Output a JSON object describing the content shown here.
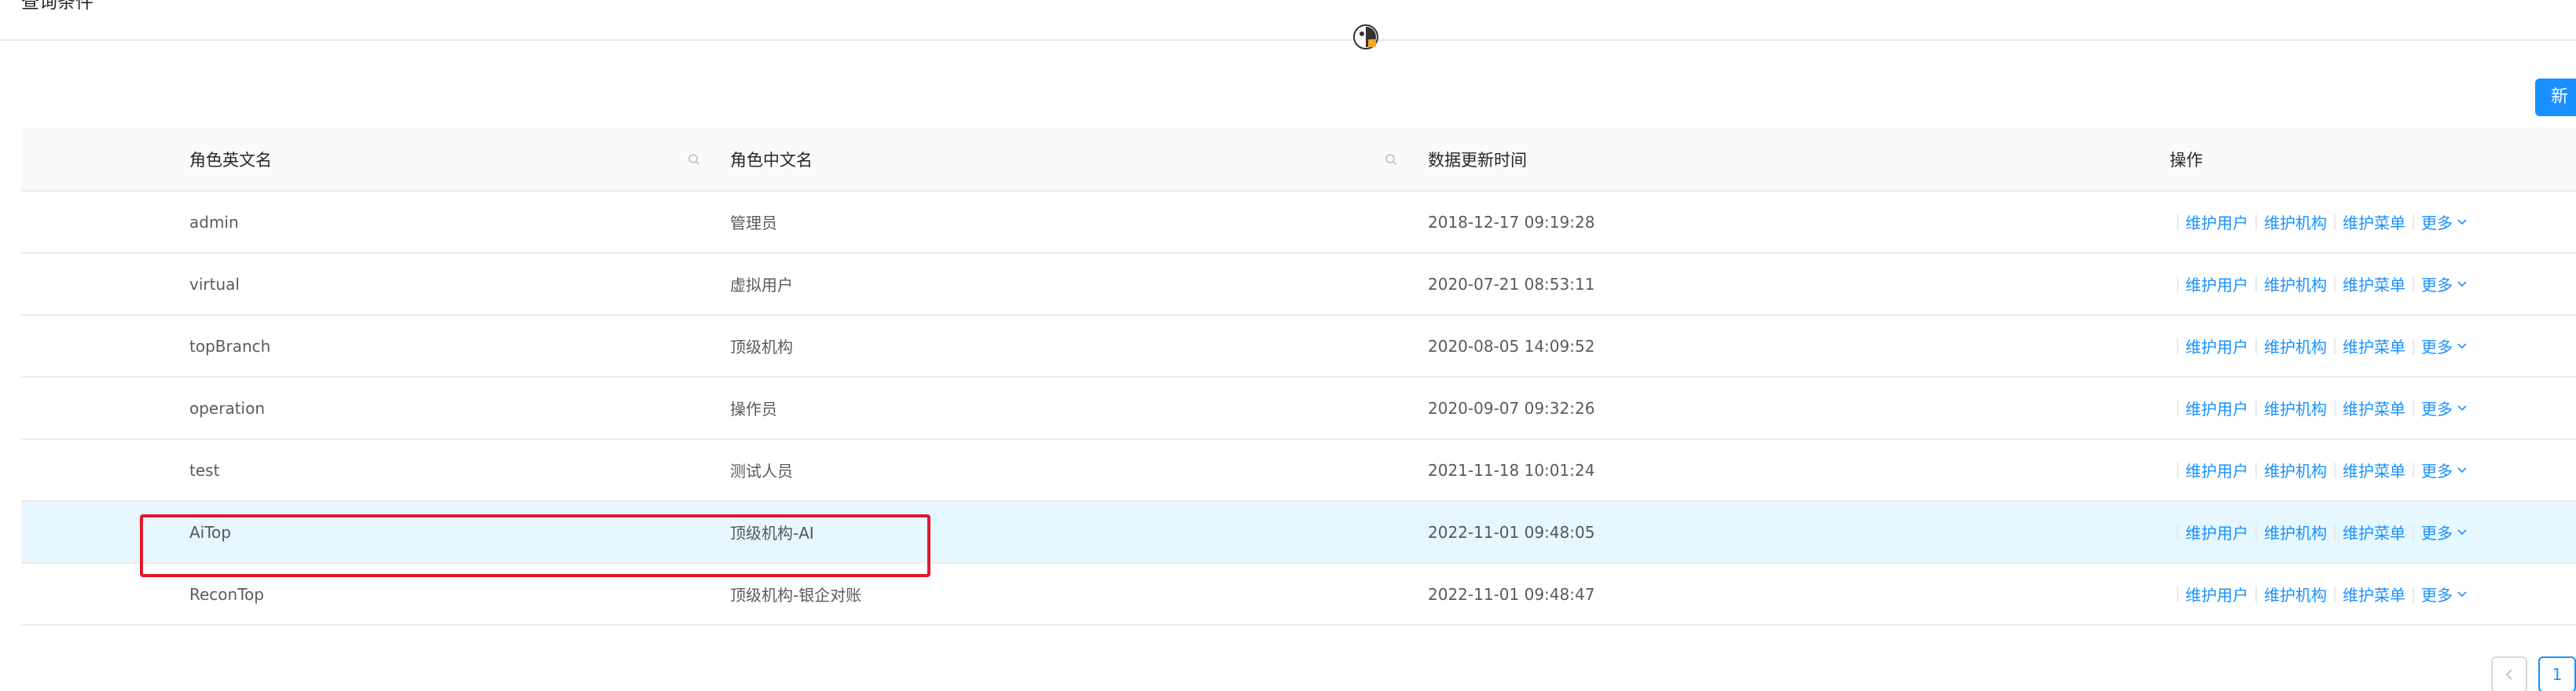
{
  "header": {
    "title": "查询条件"
  },
  "toolbar": {
    "new_label": "新"
  },
  "table": {
    "columns": {
      "role_en": "角色英文名",
      "role_zh": "角色中文名",
      "updated": "数据更新时间",
      "actions": "操作"
    },
    "action_labels": {
      "users": "维护用户",
      "orgs": "维护机构",
      "menus": "维护菜单",
      "more": "更多"
    },
    "rows": [
      {
        "role_en": "admin",
        "role_zh": "管理员",
        "updated": "2018-12-17 09:19:28"
      },
      {
        "role_en": "virtual",
        "role_zh": "虚拟用户",
        "updated": "2020-07-21 08:53:11"
      },
      {
        "role_en": "topBranch",
        "role_zh": "顶级机构",
        "updated": "2020-08-05 14:09:52"
      },
      {
        "role_en": "operation",
        "role_zh": "操作员",
        "updated": "2020-09-07 09:32:26"
      },
      {
        "role_en": "test",
        "role_zh": "测试人员",
        "updated": "2021-11-18 10:01:24"
      },
      {
        "role_en": "AiTop",
        "role_zh": "顶级机构-AI",
        "updated": "2022-11-01 09:48:05"
      },
      {
        "role_en": "ReconTop",
        "role_zh": "顶级机构-银企对账",
        "updated": "2022-11-01 09:48:47"
      }
    ],
    "highlighted_row": 5
  },
  "pagination": {
    "current_page": "1"
  },
  "colors": {
    "accent": "#1890ff",
    "highlight_row": "#e6f7ff",
    "annotation_box": "#e0192d"
  },
  "icons": {
    "filter": "search-icon",
    "more": "chevron-down-icon",
    "prev": "chevron-left-icon",
    "avatar": "avatar-icon"
  }
}
